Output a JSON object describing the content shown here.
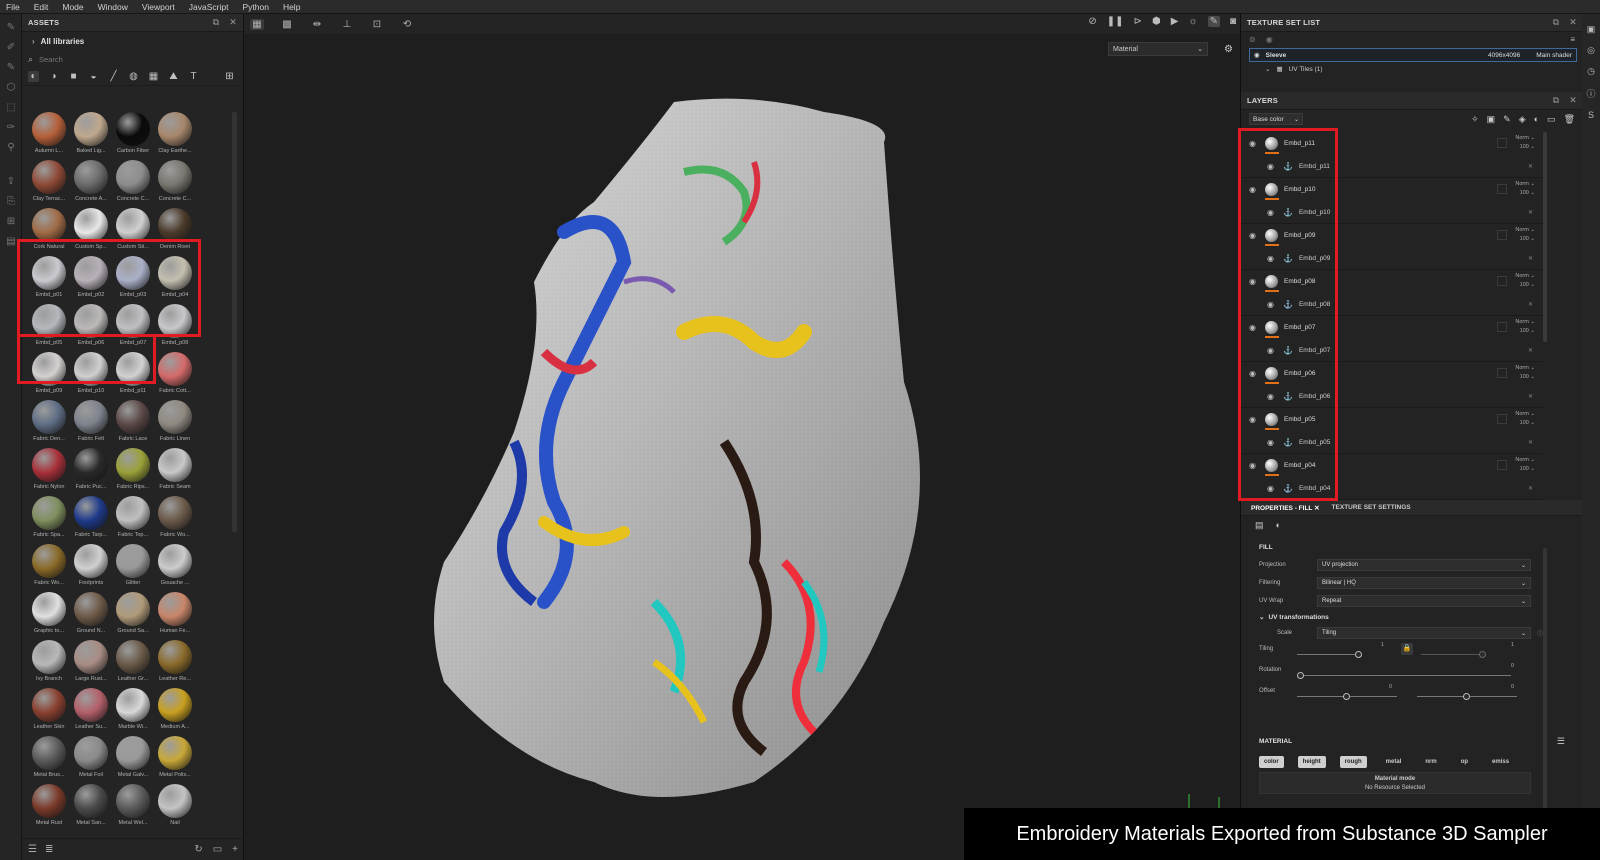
{
  "menu": [
    "File",
    "Edit",
    "Mode",
    "Window",
    "Viewport",
    "JavaScript",
    "Python",
    "Help"
  ],
  "assets": {
    "title": "ASSETS",
    "library": "All libraries",
    "search_placeholder": "Search",
    "items": [
      {
        "label": "Autumn L...",
        "color": "#b5603a"
      },
      {
        "label": "Baked Lig...",
        "color": "#bfa88e"
      },
      {
        "label": "Carbon Fiber",
        "color": "#0a0a0a"
      },
      {
        "label": "Clay Earthe...",
        "color": "#a7876b"
      },
      {
        "label": "Clay Terrac...",
        "color": "#8f4a36"
      },
      {
        "label": "Concrete A...",
        "color": "#6b6b6b"
      },
      {
        "label": "Concrete C...",
        "color": "#8d8d8d"
      },
      {
        "label": "Concrete C...",
        "color": "#7a7670"
      },
      {
        "label": "Cork Natural",
        "color": "#a06b45"
      },
      {
        "label": "Custom Sp...",
        "color": "#e8e8e8"
      },
      {
        "label": "Custom Sti...",
        "color": "#d0d0d0"
      },
      {
        "label": "Denim Rivet",
        "color": "#4a3a2a"
      },
      {
        "label": "Embd_p01",
        "color": "#c9c9cf"
      },
      {
        "label": "Embd_p02",
        "color": "#b8b0b8"
      },
      {
        "label": "Embd_p03",
        "color": "#aab0c8"
      },
      {
        "label": "Embd_p04",
        "color": "#c4c0b0"
      },
      {
        "label": "Embd_p05",
        "color": "#b4b8bc"
      },
      {
        "label": "Embd_p06",
        "color": "#bcb8b8"
      },
      {
        "label": "Embd_p07",
        "color": "#c0c0c4"
      },
      {
        "label": "Embd_p08",
        "color": "#c8c8cc"
      },
      {
        "label": "Embd_p09",
        "color": "#d4d0d0"
      },
      {
        "label": "Embd_p10",
        "color": "#cfcfcf"
      },
      {
        "label": "Embd_p11",
        "color": "#d2d2d2"
      },
      {
        "label": "Fabric Cott...",
        "color": "#d46a6a"
      },
      {
        "label": "Fabric Den...",
        "color": "#5f6e85"
      },
      {
        "label": "Fabric Felt",
        "color": "#7d828c"
      },
      {
        "label": "Fabric Lace",
        "color": "#5a4846"
      },
      {
        "label": "Fabric Linen",
        "color": "#8e8880"
      },
      {
        "label": "Fabric Nylon",
        "color": "#a8303a"
      },
      {
        "label": "Fabric Puc...",
        "color": "#2a2a2a"
      },
      {
        "label": "Fabric Rips...",
        "color": "#9aa038"
      },
      {
        "label": "Fabric Seam",
        "color": "#c8c8c8"
      },
      {
        "label": "Fabric Spa...",
        "color": "#7f8f5e"
      },
      {
        "label": "Fabric Tarp...",
        "color": "#1e3a8a"
      },
      {
        "label": "Fabric Top...",
        "color": "#c0c0c0"
      },
      {
        "label": "Fabric Wo...",
        "color": "#6b5a4a"
      },
      {
        "label": "Fabric Wo...",
        "color": "#8a6a28"
      },
      {
        "label": "Footprints",
        "color": "#d0d0d0"
      },
      {
        "label": "Glitter",
        "color": "#9a9a9a"
      },
      {
        "label": "Gouache ...",
        "color": "#cccccc"
      },
      {
        "label": "Graphic to...",
        "color": "#e0e0e0"
      },
      {
        "label": "Ground N...",
        "color": "#6e5a48"
      },
      {
        "label": "Ground Sa...",
        "color": "#b09a7a"
      },
      {
        "label": "Human Fe...",
        "color": "#c8866a"
      },
      {
        "label": "Ivy Branch",
        "color": "#b8b8b8"
      },
      {
        "label": "Large Rust...",
        "color": "#a88c84"
      },
      {
        "label": "Leather Gr...",
        "color": "#6a5a48"
      },
      {
        "label": "Leather Re...",
        "color": "#8a6a2a"
      },
      {
        "label": "Leather Skin",
        "color": "#8a4030"
      },
      {
        "label": "Leather Su...",
        "color": "#b4606a"
      },
      {
        "label": "Marble Wi...",
        "color": "#d8d8d8"
      },
      {
        "label": "Medium A...",
        "color": "#c8a020"
      },
      {
        "label": "Metal Brus...",
        "color": "#5a5a5a"
      },
      {
        "label": "Metal Foil",
        "color": "#8a8a8a"
      },
      {
        "label": "Metal Galv...",
        "color": "#9a9a9a"
      },
      {
        "label": "Metal Polis...",
        "color": "#c8a838"
      },
      {
        "label": "Metal Rust",
        "color": "#7a3a2a"
      },
      {
        "label": "Metal San...",
        "color": "#4a4a4a"
      },
      {
        "label": "Metal Wel...",
        "color": "#5a5a5a"
      },
      {
        "label": "Nail",
        "color": "#c4c4c4"
      }
    ]
  },
  "viewport": {
    "material_mode": "Material"
  },
  "texture_set_list": {
    "title": "TEXTURE SET LIST",
    "set_name": "Sleeve",
    "resolution": "4096x4096",
    "shader": "Main shader",
    "uv_tiles": "UV Tiles (1)"
  },
  "layers": {
    "title": "LAYERS",
    "channel": "Base color",
    "items": [
      {
        "name": "Embd_p11",
        "mask": "Embd_p11",
        "blend": "Norm",
        "opacity": "100"
      },
      {
        "name": "Embd_p10",
        "mask": "Embd_p10",
        "blend": "Norm",
        "opacity": "100"
      },
      {
        "name": "Embd_p09",
        "mask": "Embd_p09",
        "blend": "Norm",
        "opacity": "100"
      },
      {
        "name": "Embd_p08",
        "mask": "Embd_p08",
        "blend": "Norm",
        "opacity": "100"
      },
      {
        "name": "Embd_p07",
        "mask": "Embd_p07",
        "blend": "Norm",
        "opacity": "100"
      },
      {
        "name": "Embd_p06",
        "mask": "Embd_p06",
        "blend": "Norm",
        "opacity": "100"
      },
      {
        "name": "Embd_p05",
        "mask": "Embd_p05",
        "blend": "Norm",
        "opacity": "100"
      },
      {
        "name": "Embd_p04",
        "mask": "Embd_p04",
        "blend": "Norm",
        "opacity": "100"
      }
    ]
  },
  "properties": {
    "tab_fill": "PROPERTIES - FILL",
    "tab_tss": "TEXTURE SET SETTINGS",
    "fill_title": "FILL",
    "projection_label": "Projection",
    "projection_value": "UV projection",
    "filtering_label": "Filtering",
    "filtering_value": "Bilinear | HQ",
    "uvwrap_label": "UV Wrap",
    "uvwrap_value": "Repeat",
    "uv_transformations": "UV transformations",
    "scale_label": "Scale",
    "scale_value": "Tiling",
    "tiling_label": "Tiling",
    "tiling_value_1": "1",
    "tiling_value_2": "1",
    "rotation_label": "Rotation",
    "rotation_value": "0",
    "offset_label": "Offset",
    "offset_value_1": "0",
    "offset_value_2": "0",
    "material_title": "MATERIAL",
    "channels": [
      "color",
      "height",
      "rough",
      "metal",
      "nrm",
      "op",
      "emiss"
    ],
    "channels_on": [
      true,
      true,
      true,
      false,
      false,
      false,
      false
    ],
    "material_mode_title": "Material mode",
    "material_mode_value": "No Resource Selected"
  },
  "caption": "Embroidery Materials Exported from Substance 3D Sampler",
  "colors": {
    "highlight": "#e01b22",
    "layer_accent": "#e0701a",
    "selected_border": "#3f6b9c"
  }
}
